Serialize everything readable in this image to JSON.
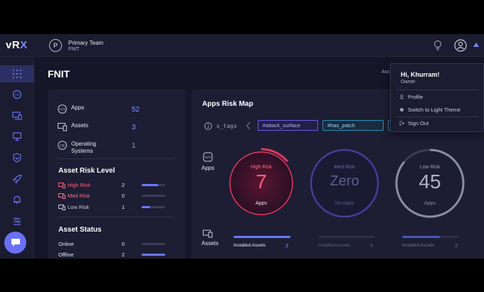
{
  "brand": {
    "logo": "vR",
    "logo_accent": "X"
  },
  "header": {
    "team_initial": "P",
    "team_name": "Primary Team",
    "team_sub": "FNIT"
  },
  "page": {
    "title": "FNIT",
    "assets_hint": "Ass"
  },
  "sidebar": {
    "items": [
      "grid-icon",
      "cloud-icon",
      "monitor-icon",
      "desktop-icon",
      "shield-icon",
      "rocket-icon",
      "bell-icon",
      "sliders-icon"
    ]
  },
  "summary": {
    "apps": {
      "label": "Apps",
      "value": "52"
    },
    "assets": {
      "label": "Assets",
      "value": "3"
    },
    "os": {
      "label": "Operating Systems",
      "value": "1"
    }
  },
  "asset_risk": {
    "title": "Asset Risk Level",
    "high": {
      "label": "High Risk",
      "value": "2",
      "fill": 0.7
    },
    "med": {
      "label": "Med Risk",
      "value": "0",
      "fill": 0
    },
    "low": {
      "label": "Low Risk",
      "value": "1",
      "fill": 0.35
    }
  },
  "asset_status": {
    "title": "Asset Status",
    "online": {
      "label": "Online",
      "value": "0",
      "fill": 0
    },
    "offline": {
      "label": "Offline",
      "value": "2",
      "fill": 1.0
    }
  },
  "risk_map": {
    "title": "Apps Risk Map",
    "tags_label": "x_tags",
    "tags": [
      "#attack_surface",
      "#has_patch"
    ],
    "row_apps": "Apps",
    "row_assets": "Assets",
    "rings": [
      {
        "label": "High Risk",
        "value": "7",
        "sub": "Apps",
        "color": "#e8355f",
        "fraction": 0.14,
        "assets_label": "Installed Assets",
        "assets_value": "2",
        "assets_fill": 1.0
      },
      {
        "label": "Med Risk",
        "value": "Zero",
        "sub": "No Apps",
        "color": "#6b4fd1",
        "fraction": 0,
        "assets_label": "Installed Assets",
        "assets_value": "0",
        "assets_fill": 0
      },
      {
        "label": "Low Risk",
        "value": "45",
        "sub": "Apps",
        "color": "#8a8d9f",
        "fraction": 0.86,
        "assets_label": "Installed Assets",
        "assets_value": "2",
        "assets_fill": 0.66
      }
    ]
  },
  "user_menu": {
    "greeting": "Hi, Khurram!",
    "role": "Owner",
    "profile": "Profile",
    "theme": "Switch to Light Theme",
    "signout": "Sign Out"
  },
  "colors": {
    "accent": "#6a70f5",
    "high": "#ff5f7d",
    "med": "#ff6f85",
    "low": "#c7c9dc"
  }
}
